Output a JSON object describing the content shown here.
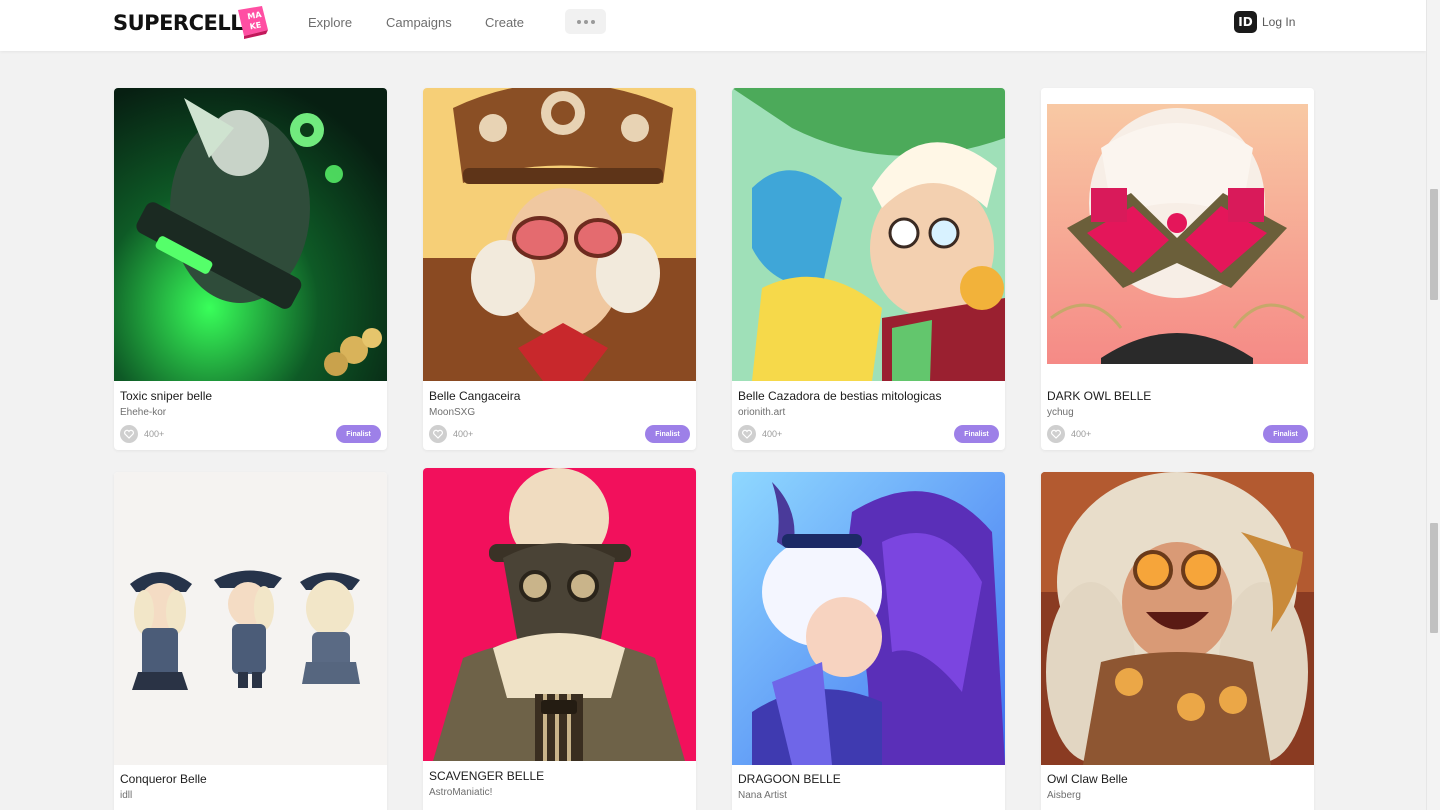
{
  "header": {
    "logo": "SUPERCELL",
    "logo_badge": "MAKE",
    "nav": [
      "Explore",
      "Campaigns",
      "Create"
    ],
    "more_icon": "more-dots-icon",
    "login_badge": "ID",
    "login_label": "Log In"
  },
  "colors": {
    "background": "#f2f2f2",
    "badge_purple": "#9d80e8",
    "make_pink": "#ff4fa3"
  },
  "cards": [
    {
      "title": "Toxic sniper belle",
      "author": "Ehehe-kor",
      "likes": "400+",
      "badge": "Finalist"
    },
    {
      "title": "Belle Cangaceira",
      "author": "MoonSXG",
      "likes": "400+",
      "badge": "Finalist"
    },
    {
      "title": "Belle Cazadora de bestias mitologicas",
      "author": "orionith.art",
      "likes": "400+",
      "badge": "Finalist"
    },
    {
      "title": "DARK OWL BELLE",
      "author": "ychug",
      "likes": "400+",
      "badge": "Finalist"
    },
    {
      "title": "Conqueror Belle",
      "author": "idll",
      "likes": "",
      "badge": ""
    },
    {
      "title": "SCAVENGER BELLE",
      "author": "AstroManiatic!",
      "likes": "",
      "badge": ""
    },
    {
      "title": "DRAGOON BELLE",
      "author": "Nana Artist",
      "likes": "",
      "badge": ""
    },
    {
      "title": "Owl Claw Belle",
      "author": "Aisberg",
      "likes": "",
      "badge": ""
    }
  ]
}
